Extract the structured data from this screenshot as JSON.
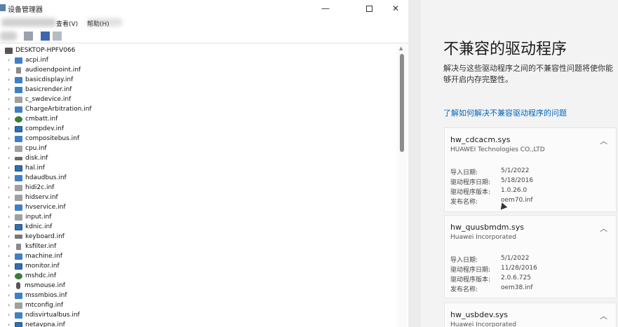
{
  "device_manager": {
    "window_title": "设备管理器",
    "menu": {
      "view": "查看(V)",
      "help": "帮助(H)"
    },
    "root_label": "DESKTOP-HPFV066",
    "items": [
      {
        "label": "acpi.inf",
        "icon": "folder-icon"
      },
      {
        "label": "audioendpoint.inf",
        "icon": "speaker-icon"
      },
      {
        "label": "basicdisplay.inf",
        "icon": "folder-icon"
      },
      {
        "label": "basicrender.inf",
        "icon": "folder-icon"
      },
      {
        "label": "c_swdevice.inf",
        "icon": "generic-device-icon"
      },
      {
        "label": "ChargeArbitration.inf",
        "icon": "folder-icon"
      },
      {
        "label": "cmbatt.inf",
        "icon": "battery-icon"
      },
      {
        "label": "compdev.inf",
        "icon": "display-icon"
      },
      {
        "label": "compositebus.inf",
        "icon": "folder-icon"
      },
      {
        "label": "cpu.inf",
        "icon": "processor-icon"
      },
      {
        "label": "disk.inf",
        "icon": "disk-icon"
      },
      {
        "label": "hal.inf",
        "icon": "display-icon"
      },
      {
        "label": "hdaudbus.inf",
        "icon": "folder-icon"
      },
      {
        "label": "hidi2c.inf",
        "icon": "hid-icon"
      },
      {
        "label": "hidserv.inf",
        "icon": "hid-icon"
      },
      {
        "label": "hvservice.inf",
        "icon": "folder-icon"
      },
      {
        "label": "input.inf",
        "icon": "hid-icon"
      },
      {
        "label": "kdnic.inf",
        "icon": "network-icon"
      },
      {
        "label": "keyboard.inf",
        "icon": "keyboard-icon"
      },
      {
        "label": "ksfilter.inf",
        "icon": "speaker-icon"
      },
      {
        "label": "machine.inf",
        "icon": "folder-icon"
      },
      {
        "label": "monitor.inf",
        "icon": "display-icon"
      },
      {
        "label": "mshdc.inf",
        "icon": "storage-controller-icon"
      },
      {
        "label": "msmouse.inf",
        "icon": "mouse-icon"
      },
      {
        "label": "mssmbios.inf",
        "icon": "folder-icon"
      },
      {
        "label": "mtconfig.inf",
        "icon": "hid-icon"
      },
      {
        "label": "ndisvirtualbus.inf",
        "icon": "folder-icon"
      },
      {
        "label": "netavpna.inf",
        "icon": "network-icon"
      }
    ]
  },
  "security_panel": {
    "title": "不兼容的驱动程序",
    "description": "解决与这些驱动程序之间的不兼容性问题将使你能够开启内存完整性。",
    "link": "了解如何解决不兼容驱动程序的问题",
    "field_labels": {
      "import_date": "导入日期:",
      "driver_date": "驱动程序日期:",
      "driver_version": "驱动程序版本:",
      "published_name": "发布名称:"
    },
    "drivers": [
      {
        "name": "hw_cdcacm.sys",
        "vendor": "HUAWEI Technologies CO.,LTD",
        "import_date": "5/1/2022",
        "driver_date": "5/18/2016",
        "driver_version": "1.0.26.0",
        "published_name": "oem70.inf"
      },
      {
        "name": "hw_quusbmdm.sys",
        "vendor": "Huawei Incorporated",
        "import_date": "5/1/2022",
        "driver_date": "11/28/2016",
        "driver_version": "2.0.6.725",
        "published_name": "oem38.inf"
      },
      {
        "name": "hw_usbdev.sys",
        "vendor": "Huawei Incorporated"
      }
    ]
  }
}
